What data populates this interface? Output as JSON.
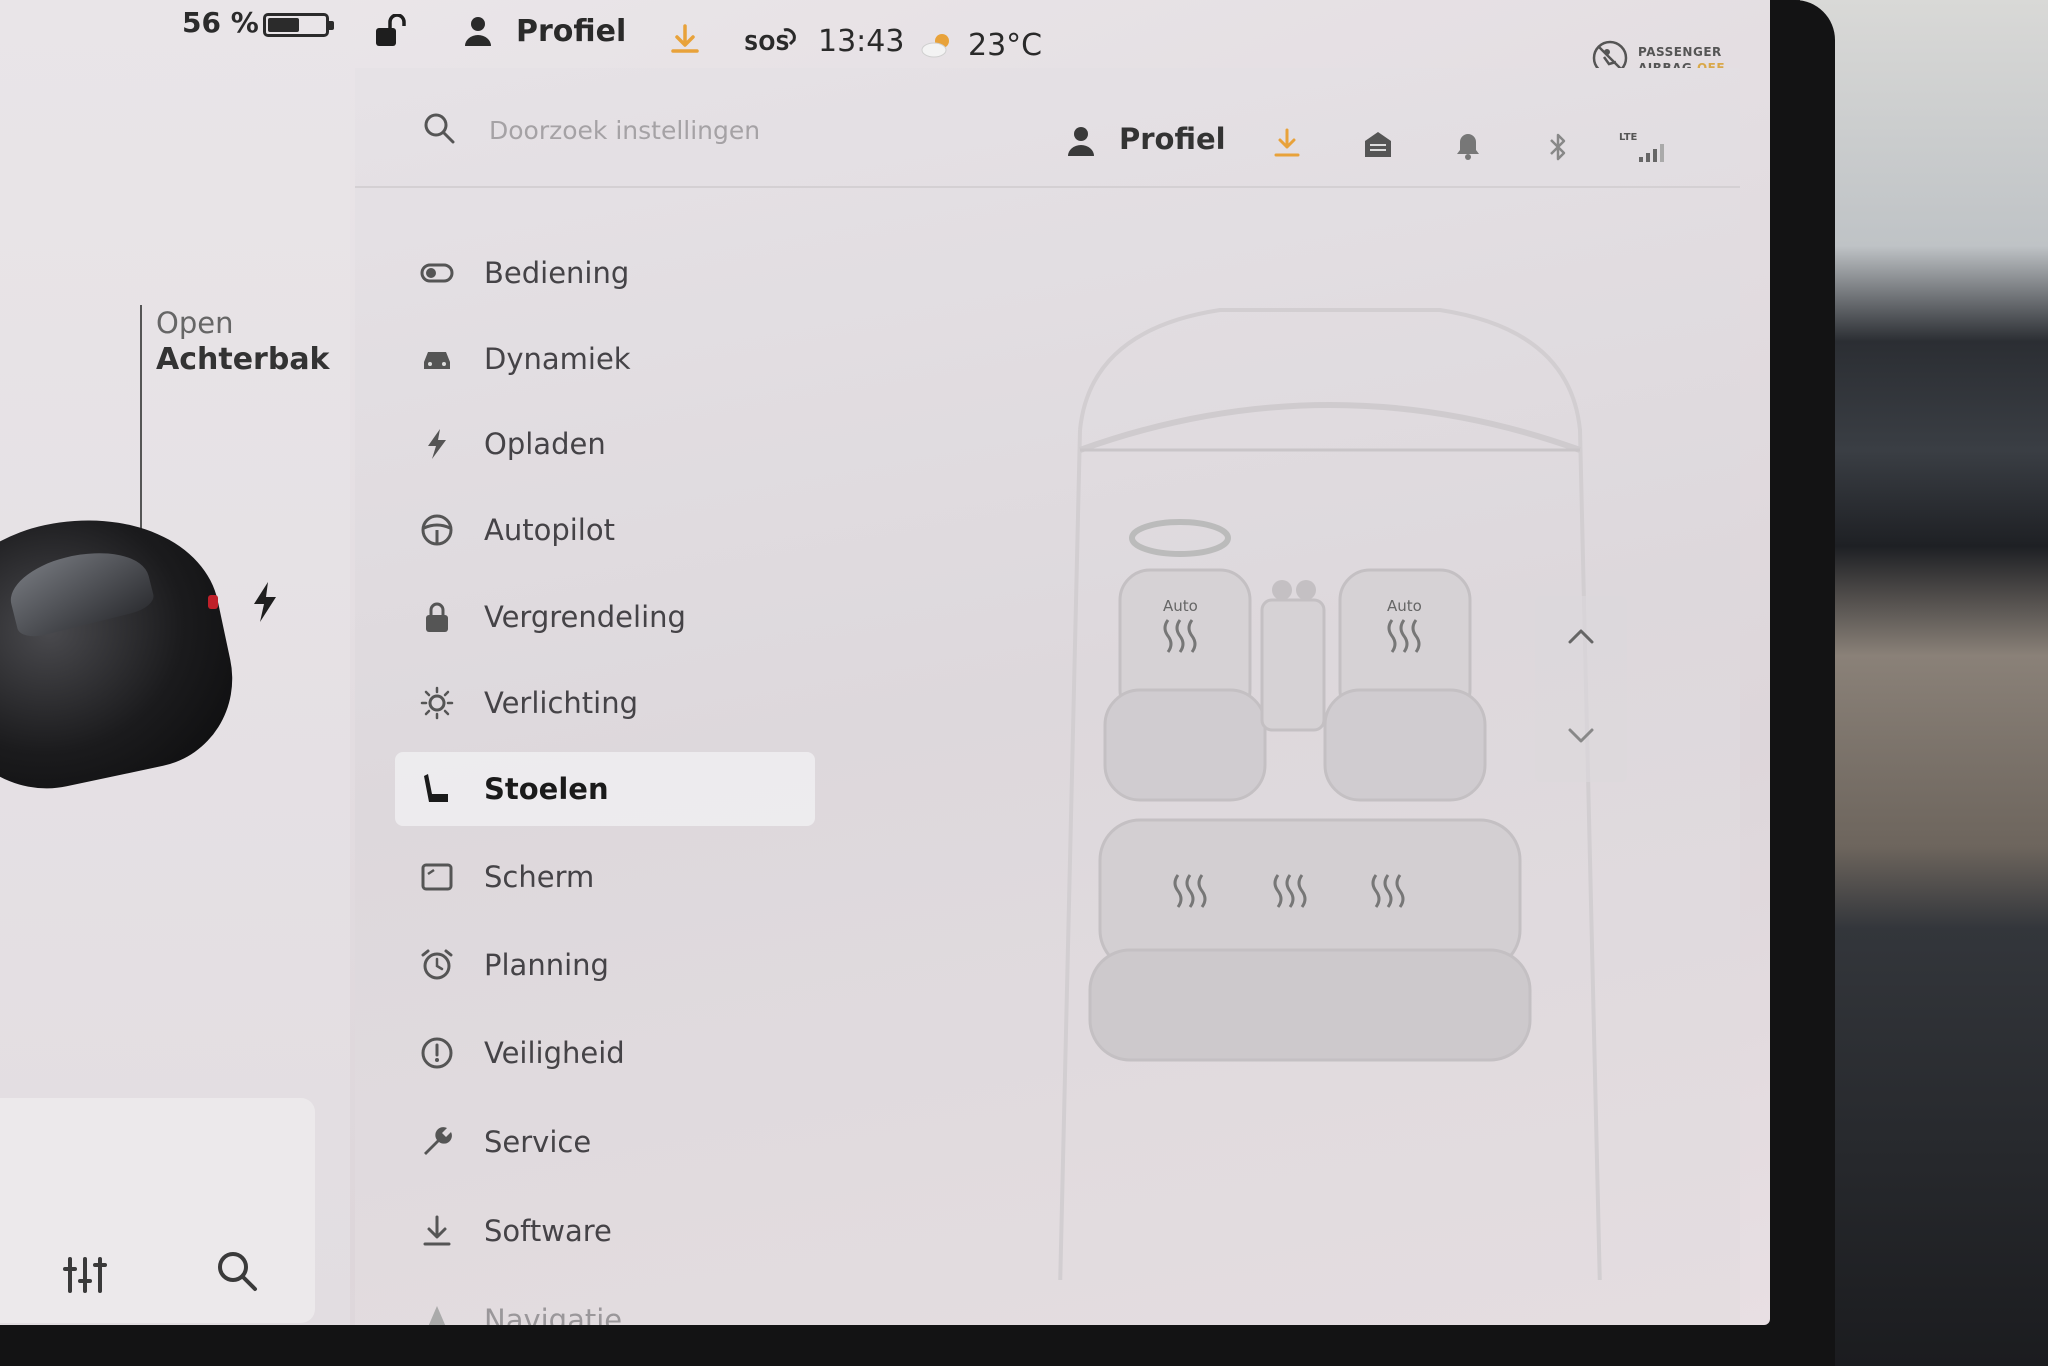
{
  "status_bar": {
    "battery_percent": "56 %",
    "battery_level": 0.56,
    "profile_label": "Profiel",
    "sos_label": "SOS",
    "time": "13:43",
    "temperature": "23°C",
    "airbag_line1": "PASSENGER",
    "airbag_line2": "AIRBAG",
    "airbag_state": "OFF"
  },
  "left_panel": {
    "trunk_open": "Open",
    "trunk_label": "Achterbak"
  },
  "settings_header": {
    "search_placeholder": "Doorzoek instellingen",
    "profile_label": "Profiel",
    "lte_label": "LTE"
  },
  "menu": {
    "items": [
      {
        "label": "Bediening",
        "icon": "toggle-icon"
      },
      {
        "label": "Dynamiek",
        "icon": "car-icon"
      },
      {
        "label": "Opladen",
        "icon": "lightning-icon"
      },
      {
        "label": "Autopilot",
        "icon": "steering-wheel-icon"
      },
      {
        "label": "Vergrendeling",
        "icon": "lock-icon"
      },
      {
        "label": "Verlichting",
        "icon": "sun-icon"
      },
      {
        "label": "Stoelen",
        "icon": "seat-icon"
      },
      {
        "label": "Scherm",
        "icon": "display-icon"
      },
      {
        "label": "Planning",
        "icon": "alarm-clock-icon"
      },
      {
        "label": "Veiligheid",
        "icon": "alert-circle-icon"
      },
      {
        "label": "Service",
        "icon": "wrench-icon"
      },
      {
        "label": "Software",
        "icon": "download-icon"
      },
      {
        "label": "Navigatie",
        "icon": "navigation-icon"
      }
    ],
    "active": "Stoelen"
  },
  "seats": {
    "front_left_label": "Auto",
    "front_right_label": "Auto"
  },
  "colors": {
    "accent_orange": "#e8a23a",
    "text_dark": "#2a2a2a",
    "airbag_off": "#d9a84a"
  }
}
